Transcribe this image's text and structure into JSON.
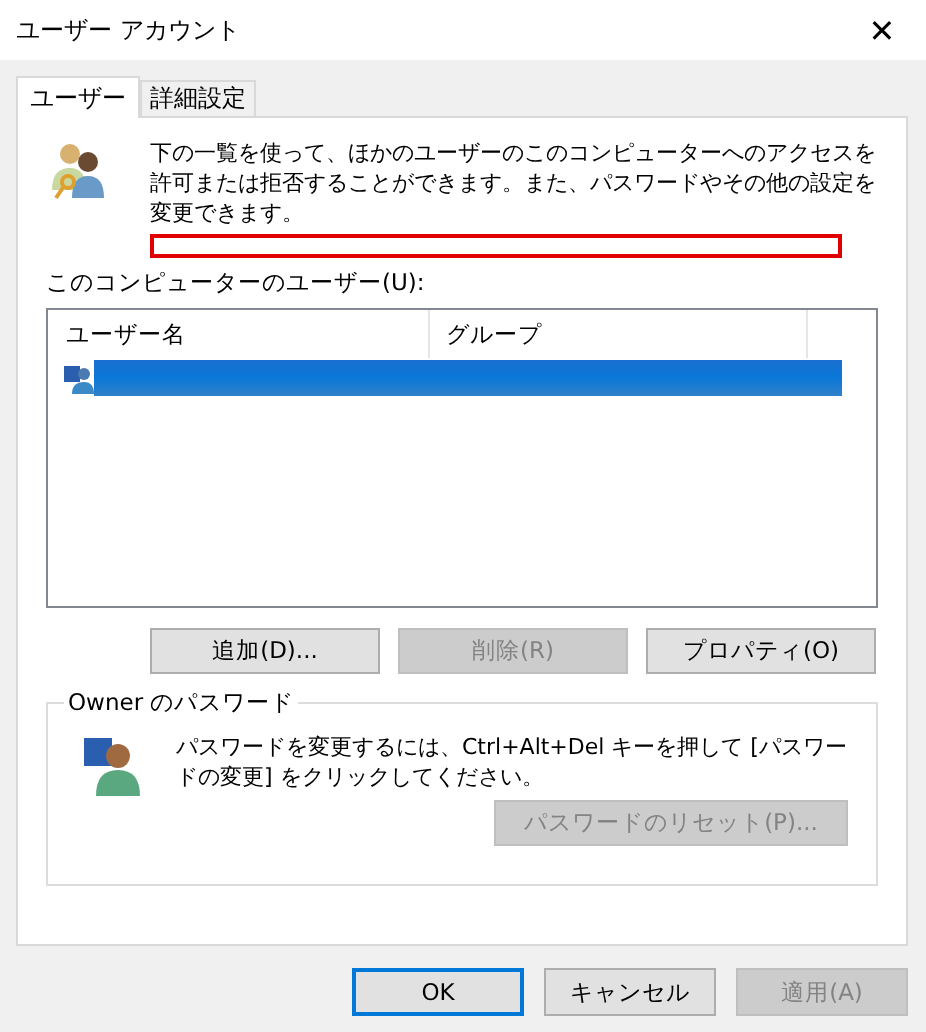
{
  "window": {
    "title": "ユーザー アカウント",
    "close": "✕"
  },
  "tabs": [
    {
      "label": "ユーザー",
      "selected": true
    },
    {
      "label": "詳細設定",
      "selected": false
    }
  ],
  "intro": "下の一覧を使って、ほかのユーザーのこのコンピューターへのアクセスを許可または拒否することができます。また、パスワードやその他の設定を変更できます。",
  "users_label": "このコンピューターのユーザー(U):",
  "table": {
    "columns": [
      "ユーザー名",
      "グループ"
    ],
    "rows": [
      {
        "selected": true
      }
    ]
  },
  "list_buttons": [
    {
      "label": "追加(D)...",
      "disabled": false
    },
    {
      "label": "削除(R)",
      "disabled": true
    },
    {
      "label": "プロパティ(O)",
      "disabled": false
    }
  ],
  "password_group": {
    "title": "Owner のパスワード",
    "text": "パスワードを変更するには、Ctrl+Alt+Del キーを押して [パスワードの変更] をクリックしてください。",
    "reset_button": {
      "label": "パスワードのリセット(P)...",
      "disabled": true
    }
  },
  "dialog_buttons": [
    {
      "label": "OK",
      "disabled": false,
      "default": true
    },
    {
      "label": "キャンセル",
      "disabled": false,
      "default": false
    },
    {
      "label": "適用(A)",
      "disabled": true,
      "default": false
    }
  ]
}
